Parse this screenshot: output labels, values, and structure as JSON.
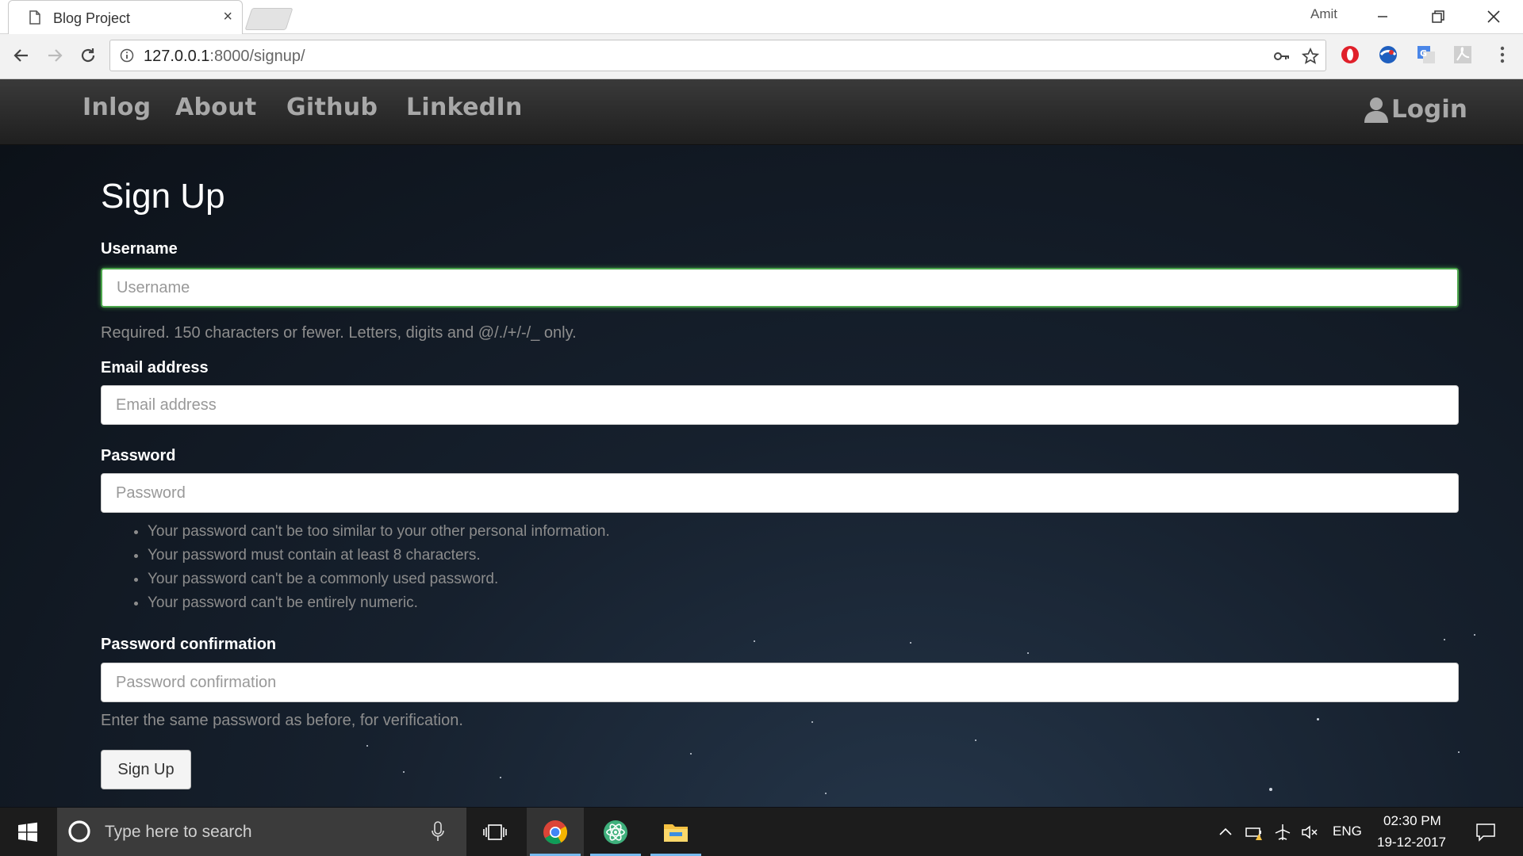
{
  "browser": {
    "tab_title": "Blog Project",
    "tab_close": "×",
    "profile_name": "Amit",
    "url_host": "127.0.0.1",
    "url_rest": ":8000/signup/"
  },
  "navbar": {
    "brand": "Inlog",
    "links": [
      "About",
      "Github",
      "LinkedIn"
    ],
    "login_label": "Login"
  },
  "form": {
    "title": "Sign Up",
    "username": {
      "label": "Username",
      "placeholder": "Username",
      "help": "Required. 150 characters or fewer. Letters, digits and @/./+/-/_ only."
    },
    "email": {
      "label": "Email address",
      "placeholder": "Email address"
    },
    "password": {
      "label": "Password",
      "placeholder": "Password",
      "rules": [
        "Your password can't be too similar to your other personal information.",
        "Your password must contain at least 8 characters.",
        "Your password can't be a commonly used password.",
        "Your password can't be entirely numeric."
      ]
    },
    "password_confirmation": {
      "label": "Password confirmation",
      "placeholder": "Password confirmation",
      "help": "Enter the same password as before, for verification."
    },
    "submit_label": "Sign Up"
  },
  "taskbar": {
    "search_placeholder": "Type here to search",
    "language": "ENG",
    "time": "02:30 PM",
    "date": "19-12-2017"
  },
  "colors": {
    "nav_text": "#a8a8a8",
    "focus_border": "#4ca64c",
    "taskbar_accent": "#76b9ed"
  }
}
